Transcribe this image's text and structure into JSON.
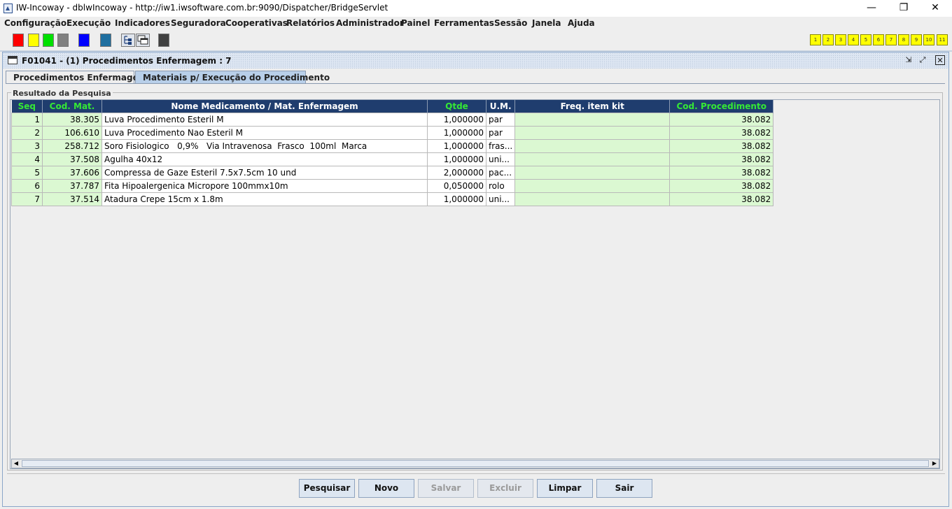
{
  "window": {
    "title": "IW-Incoway - dblwIncoway - http://iw1.iwsoftware.com.br:9090/Dispatcher/BridgeServlet",
    "minimize_glyph": "—",
    "restore_glyph": "❐",
    "close_glyph": "✕"
  },
  "menu": [
    "Configuração",
    "Execução",
    "Indicadores",
    "Seguradora",
    "Cooperativas",
    "Relatórios",
    "Administrador",
    "Painel",
    "Ferramentas",
    "Sessão",
    "Janela",
    "Ajuda"
  ],
  "toolbar": {
    "colors": [
      "#ff0000",
      "#ffff00",
      "#00e000",
      "#808080",
      "#0000ff",
      "#1f6fa0",
      "#404040"
    ],
    "numbered_buttons": [
      "1",
      "2",
      "3",
      "4",
      "5",
      "6",
      "7",
      "8",
      "9",
      "10",
      "11"
    ]
  },
  "frame": {
    "title": "F01041 - (1) Procedimentos Enfermagem : 7",
    "minimize_glyph": "⇲",
    "maximize_glyph": "⤢",
    "close_glyph": "✕"
  },
  "tabs": [
    {
      "label": "Procedimentos Enfermagem",
      "active": false
    },
    {
      "label": "Materiais p/ Execução do Procedimento",
      "active": true
    }
  ],
  "group_label": "Resultado da Pesquisa",
  "table": {
    "columns": [
      "Seq",
      "Cod. Mat.",
      "Nome Medicamento / Mat. Enfermagem",
      "Qtde",
      "U.M.",
      "Freq. item kit",
      "Cod. Procedimento"
    ],
    "rows": [
      {
        "seq": "1",
        "cod": "38.305",
        "nome": "Luva Procedimento Esteril M",
        "qtde": "1,000000",
        "um": "par",
        "freq": "",
        "proc": "38.082"
      },
      {
        "seq": "2",
        "cod": "106.610",
        "nome": "Luva Procedimento Nao Esteril M",
        "qtde": "1,000000",
        "um": "par",
        "freq": "",
        "proc": "38.082"
      },
      {
        "seq": "3",
        "cod": "258.712",
        "nome": "Soro Fisiologico   0,9%   Via Intravenosa  Frasco  100ml  Marca",
        "qtde": "1,000000",
        "um": "fras...",
        "freq": "",
        "proc": "38.082"
      },
      {
        "seq": "4",
        "cod": "37.508",
        "nome": "Agulha 40x12",
        "qtde": "1,000000",
        "um": "uni...",
        "freq": "",
        "proc": "38.082"
      },
      {
        "seq": "5",
        "cod": "37.606",
        "nome": "Compressa de Gaze Esteril 7.5x7.5cm 10 und",
        "qtde": "2,000000",
        "um": "pac...",
        "freq": "",
        "proc": "38.082"
      },
      {
        "seq": "6",
        "cod": "37.787",
        "nome": "Fita Hipoalergenica Micropore 100mmx10m",
        "qtde": "0,050000",
        "um": "rolo",
        "freq": "",
        "proc": "38.082"
      },
      {
        "seq": "7",
        "cod": "37.514",
        "nome": "Atadura Crepe 15cm x 1.8m",
        "qtde": "1,000000",
        "um": "uni...",
        "freq": "",
        "proc": "38.082"
      }
    ]
  },
  "scrollbar": {
    "left_arrow": "◀",
    "right_arrow": "▶"
  },
  "buttons": [
    {
      "label": "Pesquisar",
      "enabled": true
    },
    {
      "label": "Novo",
      "enabled": true
    },
    {
      "label": "Salvar",
      "enabled": false
    },
    {
      "label": "Excluir",
      "enabled": false
    },
    {
      "label": "Limpar",
      "enabled": true
    },
    {
      "label": "Sair",
      "enabled": true
    }
  ]
}
